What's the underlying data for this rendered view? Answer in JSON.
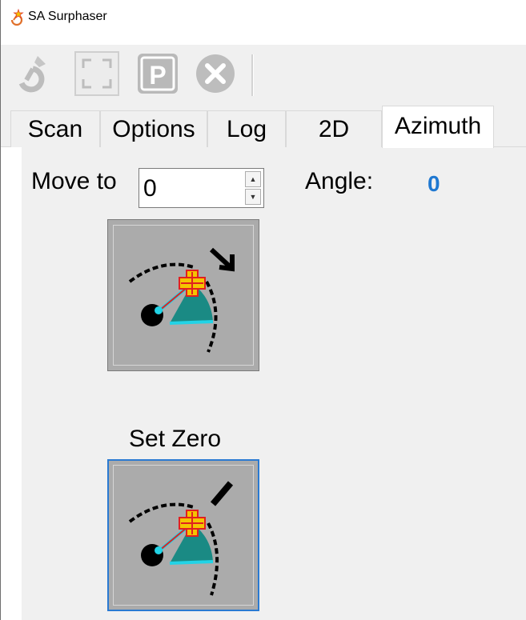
{
  "window": {
    "title": "SA Surphaser",
    "app_icon": "surphaser-logo-icon"
  },
  "toolbar": {
    "buttons": [
      {
        "name": "scan-icon",
        "label": ""
      },
      {
        "name": "frame-icon",
        "label": ""
      },
      {
        "name": "parking-icon",
        "label": "P"
      },
      {
        "name": "cancel-icon",
        "label": ""
      }
    ]
  },
  "tabs": [
    {
      "label": "Scan"
    },
    {
      "label": "Options"
    },
    {
      "label": "Log"
    },
    {
      "label": "2D"
    },
    {
      "label": "Azimuth",
      "active": true
    }
  ],
  "azimuth": {
    "move_to_label": "Move to",
    "move_to_value": "0",
    "angle_label": "Angle:",
    "angle_value": "0",
    "move_button_icon": "rotate-to-angle-icon",
    "set_zero_label": "Set Zero",
    "set_zero_icon": "set-zero-icon"
  },
  "colors": {
    "accent": "#1f78d1",
    "focus_border": "#2a7ad2",
    "button_face": "#ababab",
    "teal": "#1a8a84",
    "cyan": "#22d3e6"
  }
}
